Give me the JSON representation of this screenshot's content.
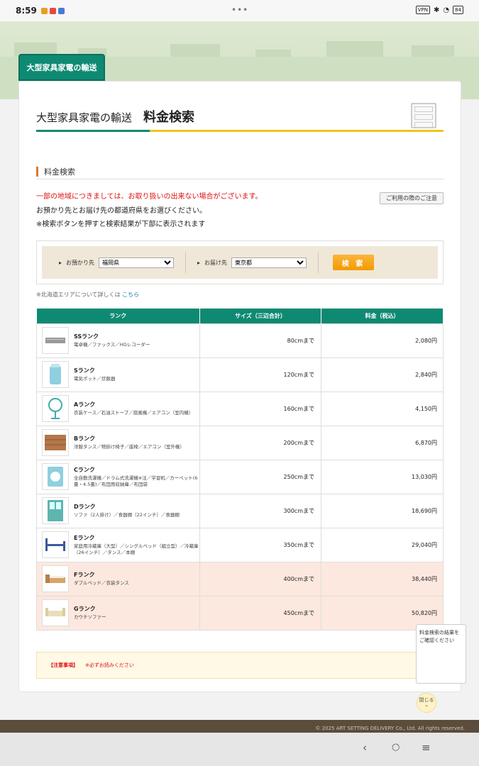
{
  "status": {
    "time": "8:59",
    "battery": "84"
  },
  "tab": {
    "label": "大型家具家電の輸送"
  },
  "header": {
    "subtitle": "大型家具家電の輸送",
    "title": "料金検索"
  },
  "section": {
    "title": "料金検索"
  },
  "messages": {
    "warning": "一部の地域につきましては、お取り扱いの出来ない場合がございます。",
    "line2": "お預かり先とお届け先の都道府県をお選びください。",
    "line3": "※検索ボタンを押すと検索結果が下部に表示されます"
  },
  "note_button": "ご利用の際のご注意",
  "search": {
    "from_label": "お預かり先",
    "from_value": "福岡県",
    "to_label": "お届け先",
    "to_value": "東京都",
    "button": "検 索"
  },
  "hokkaido": {
    "text": "※北海道エリアについて詳しくは ",
    "link": "こちら"
  },
  "table": {
    "headers": [
      "ランク",
      "サイズ（三辺合計）",
      "料金（税込）"
    ],
    "rows": [
      {
        "rank": "SSランク",
        "desc": "電卓機／ファックス／HDレコーダー",
        "size": "80cmまで",
        "price": "2,080円",
        "icon": "recorder-icon",
        "pink": false
      },
      {
        "rank": "Sランク",
        "desc": "電気ポット／炊飯器",
        "size": "120cmまで",
        "price": "2,840円",
        "icon": "pot-icon",
        "pink": false
      },
      {
        "rank": "Aランク",
        "desc": "衣装ケース／石油ストーブ／扇風機／エアコン（室内機）",
        "size": "160cmまで",
        "price": "4,150円",
        "icon": "fan-icon",
        "pink": false
      },
      {
        "rank": "Bランク",
        "desc": "洋服タンス／物掛け椅子／座椅／エアコン（室外機）",
        "size": "200cmまで",
        "price": "6,870円",
        "icon": "drawer-icon",
        "pink": false
      },
      {
        "rank": "Cランク",
        "desc": "全自動洗濯機／ドラム式洗濯機※注／学習机／カーペット(6畳・4.5畳)／布団用収納庫／布団袋",
        "size": "250cmまで",
        "price": "13,030円",
        "icon": "washer-icon",
        "pink": false
      },
      {
        "rank": "Dランク",
        "desc": "ソファ（2人掛け）／食器棚（22インチ）／食器棚",
        "size": "300cmまで",
        "price": "18,690円",
        "icon": "cabinet-icon",
        "pink": false
      },
      {
        "rank": "Eランク",
        "desc": "家庭用冷蔵庫（大型）／シングルベッド（組立型）／冷蔵庫（26インチ）／タンス／本棚",
        "size": "350cmまで",
        "price": "29,040円",
        "icon": "bed-frame-icon",
        "pink": false
      },
      {
        "rank": "Fランク",
        "desc": "ダブルベッド／衣装タンス",
        "size": "400cmまで",
        "price": "38,440円",
        "icon": "double-bed-icon",
        "pink": true
      },
      {
        "rank": "Gランク",
        "desc": "カウチソファー",
        "size": "450cmまで",
        "price": "50,820円",
        "icon": "sofa-icon",
        "pink": true
      }
    ]
  },
  "notice": {
    "title": "【注意事項】",
    "sub": "※必ずお読みください"
  },
  "float_box": {
    "text": "料金検索の結果をご確認ください"
  },
  "close_button": "閉じる",
  "footer": "© 2025 ART SETTING DELIVERY Co., Ltd. All rights reserved.",
  "colors": {
    "brand_green": "#0e8a73",
    "accent_yellow": "#f0c419",
    "search_orange": "#f39a00",
    "pink_row": "#fde8df",
    "warning_red": "#d11111"
  }
}
